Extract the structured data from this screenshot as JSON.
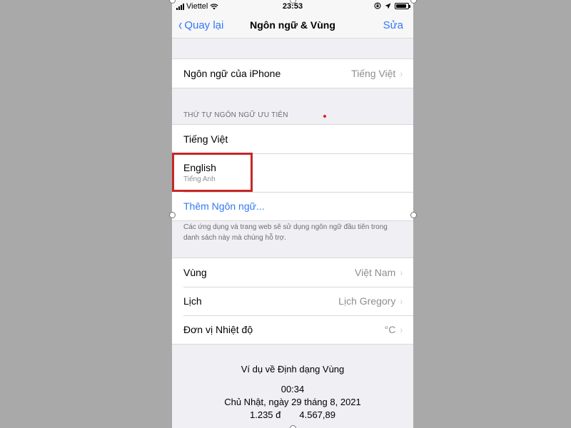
{
  "status_bar": {
    "carrier": "Viettel",
    "time": "23:53",
    "icons": [
      "signal-icon",
      "wifi-icon",
      "lock-rotation-icon",
      "location-icon",
      "battery-icon"
    ]
  },
  "nav": {
    "back_label": "Quay lại",
    "title": "Ngôn ngữ & Vùng",
    "edit_label": "Sửa"
  },
  "iphone_language": {
    "label": "Ngôn ngữ của iPhone",
    "value": "Tiếng Việt"
  },
  "preferred_languages": {
    "header": "THỨ TỰ NGÔN NGỮ ƯU TIÊN",
    "items": [
      {
        "label": "Tiếng Việt"
      },
      {
        "label": "English",
        "sublabel": "Tiếng Anh"
      }
    ],
    "add_label": "Thêm Ngôn ngữ...",
    "footer": "Các ứng dụng và trang web sẽ sử dụng ngôn ngữ đầu tiên trong danh sách này mà chúng hỗ trợ."
  },
  "region_settings": [
    {
      "label": "Vùng",
      "value": "Việt Nam"
    },
    {
      "label": "Lịch",
      "value": "Lịch Gregory"
    },
    {
      "label": "Đơn vị Nhiệt độ",
      "value": "°C"
    }
  ],
  "format_example": {
    "title": "Ví dụ về Định dạng Vùng",
    "time": "00:34",
    "date": "Chủ Nhật, ngày 29 tháng 8, 2021",
    "currency": "1.235 đ",
    "number": "4.567,89"
  },
  "colors": {
    "accent": "#3478f6",
    "highlight": "#c62828",
    "background": "#efeff4"
  },
  "chevron": "›",
  "back_chevron": "‹"
}
